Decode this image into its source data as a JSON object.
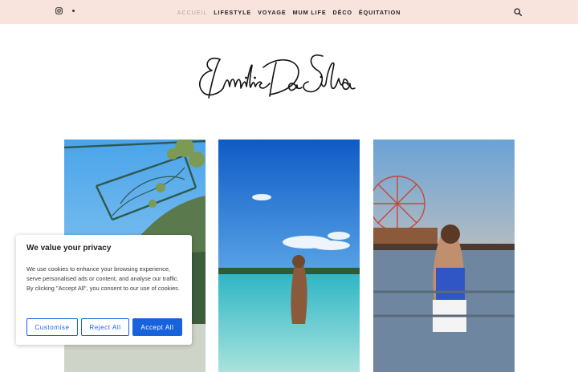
{
  "header": {
    "nav": [
      {
        "label": "ACCUEIL",
        "active": true
      },
      {
        "label": "LIFESTYLE"
      },
      {
        "label": "VOYAGE"
      },
      {
        "label": "MUM LIFE"
      },
      {
        "label": "DÉCO"
      },
      {
        "label": "ÉQUITATION"
      }
    ],
    "social_icons": [
      "instagram-icon",
      "dot-separator"
    ],
    "search_icon": "search-icon",
    "background_color": "#f9e3dd"
  },
  "logo": {
    "text": "Emilie Da Silva"
  },
  "posts": [
    {
      "image": "terrace-ironwork-mountain-photo"
    },
    {
      "image": "beach-woman-in-water-photo"
    },
    {
      "image": "pier-ferris-wheel-woman-photo"
    }
  ],
  "cookie_banner": {
    "title": "We value your privacy",
    "body": "We use cookies to enhance your browsing experience, serve personalised ads or content, and analyse our traffic. By clicking \"Accept All\", you consent to our use of cookies.",
    "buttons": {
      "customise": "Customise",
      "reject": "Reject All",
      "accept": "Accept All"
    },
    "accent_color": "#1863dc"
  }
}
